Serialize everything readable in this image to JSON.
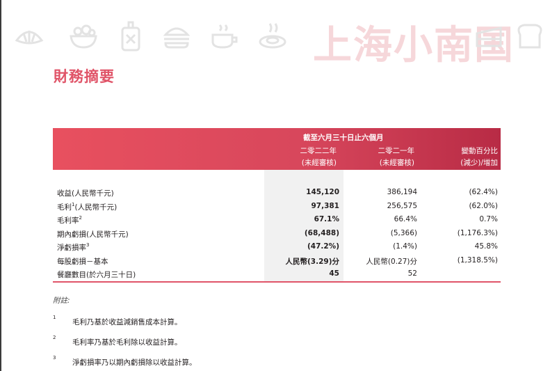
{
  "watermark_text": "上海小南国",
  "decor_icons": [
    "croissant-icon",
    "salad-bowl-icon",
    "cutting-board-icon",
    "burger-icon",
    "coffee-cup-icon",
    "steaming-dish-icon",
    "cake-slice-icon",
    "bread-icon"
  ],
  "title": "財務摘要",
  "table": {
    "period_header": "截至六月三十日止六個月",
    "columns": [
      {
        "line1": "二零二二年",
        "line2": "(未經審核)"
      },
      {
        "line1": "二零二一年",
        "line2": "(未經審核)"
      },
      {
        "line1": "變動百分比",
        "line2": "(減少)/增加"
      }
    ],
    "rows": [
      {
        "label": "收益(人民幣千元)",
        "sup": "",
        "v2022": "145,120",
        "v2021": "386,194",
        "change": "(62.4%)"
      },
      {
        "label": "毛利",
        "sup": "1",
        "label_suffix": "(人民幣千元)",
        "v2022": "97,381",
        "v2021": "256,575",
        "change": "(62.0%)"
      },
      {
        "label": "毛利率",
        "sup": "2",
        "v2022": "67.1%",
        "v2021": "66.4%",
        "change": "0.7%"
      },
      {
        "label": "期內虧損(人民幣千元)",
        "sup": "",
        "v2022": "(68,488)",
        "v2021": "(5,366)",
        "change": "(1,176.3%)"
      },
      {
        "label": "淨虧損率",
        "sup": "3",
        "v2022": "(47.2%)",
        "v2021": "(1.4%)",
        "change": "45.8%"
      },
      {
        "label": "每股虧損－基本",
        "sup": "",
        "v2022": "人民幣(3.29)分",
        "v2021": "人民幣(0.27)分",
        "change": "(1,318.5%)"
      },
      {
        "label": "餐廳數目(於六月三十日)",
        "sup": "",
        "v2022": "45",
        "v2021": "52",
        "change": ""
      }
    ]
  },
  "notes": {
    "title": "附註:",
    "items": [
      {
        "num": "1",
        "text": "毛利乃基於收益減銷售成本計算。"
      },
      {
        "num": "2",
        "text": "毛利率乃基於毛利除以收益計算。"
      },
      {
        "num": "3",
        "text": "淨虧損率乃以期內虧損除以收益計算。"
      }
    ]
  },
  "colors": {
    "accent": "#e05468",
    "header_start": "#e8505f",
    "header_end": "#b82b45",
    "shade": "#f1f1f1",
    "watermark": "#f6d3d7"
  }
}
